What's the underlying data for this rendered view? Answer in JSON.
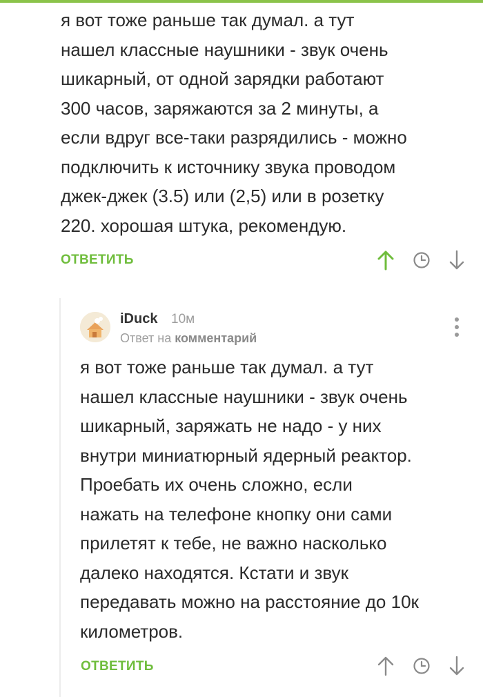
{
  "comment1": {
    "text": "я вот тоже раньше так думал. а тут\nнашел классные наушники - звук очень\nшикарный, от одной зарядки работают\n300 часов, заряжаются за 2 минуты, а\nесли вдруг все-таки разрядились - можно\nподключить к источнику звука проводом\nджек-джек (3.5) или (2,5) или в розетку\n220. хорошая штука, рекомендую.",
    "reply_label": "ОТВЕТИТЬ"
  },
  "comment2": {
    "username": "iDuck",
    "time": "10м",
    "reply_to_prefix": "Ответ на",
    "reply_to_target": "комментарий",
    "text": "я вот тоже раньше так думал. а тут\nнашел классные наушники - звук очень\nшикарный, заряжать не надо - у них\nвнутри миниатюрный ядерный реактор.\nПроебать их очень сложно, если\nнажать на телефоне кнопку они сами\nприлетят к тебе, не важно насколько\nдалеко находятся. Кстати и звук\nпередавать можно на расстояние до 10к\nкилометров.",
    "reply_label": "ОТВЕТИТЬ"
  },
  "icons": {
    "upvote": "arrow-up-icon",
    "clock": "clock-icon",
    "downvote": "arrow-down-icon",
    "menu": "more-vertical-icon"
  },
  "colors": {
    "accent": "#6fbd3c",
    "upvote_active": "#6fbd3c",
    "icon_gray": "#8a8a8a"
  }
}
